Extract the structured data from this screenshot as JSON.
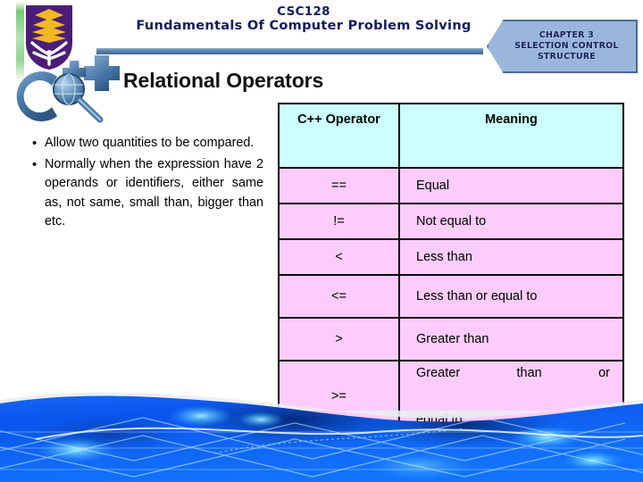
{
  "slide": {
    "course_code": "CSC128",
    "course_name": "Fundamentals Of Computer Problem Solving",
    "title": "Relational Operators",
    "chapter_banner": {
      "line1": "CHAPTER 3",
      "line2": "SELECTION CONTROL",
      "line3": "STRUCTURE"
    },
    "bullets": [
      "Allow two quantities to be compared.",
      "Normally when the expression have 2 operands or identifiers, either same as, not same, small than, bigger than etc."
    ],
    "table": {
      "headers": [
        "C++ Operator",
        "Meaning"
      ],
      "rows": [
        {
          "operator": "==",
          "meaning": "Equal"
        },
        {
          "operator": "!=",
          "meaning": "Not equal to"
        },
        {
          "operator": "<",
          "meaning": "Less than"
        },
        {
          "operator": "<=",
          "meaning": "Less than or equal to"
        },
        {
          "operator": ">",
          "meaning": "Greater than"
        },
        {
          "operator": ">=",
          "meaning": "Greater than or equal to",
          "line1": "Greater than or",
          "line2": "equal to"
        }
      ]
    },
    "colors": {
      "header_text": "#131a5e",
      "banner_fill": "#9ab6dd",
      "banner_border": "#4a6b94",
      "rule": "#5b82ab",
      "table_header_bg": "#ccffff",
      "table_row_bg": "#fccdfc",
      "table_border": "#050308",
      "footer_blue": "#0a5cf5",
      "logo_purple": "#4b1d78",
      "logo_gold": "#f2b820"
    },
    "graphics": {
      "university_logo": "uitm-shield-logo",
      "cpp_logo": "cpp-magnifier-logo",
      "footer": "blue-wave-graphic"
    }
  }
}
